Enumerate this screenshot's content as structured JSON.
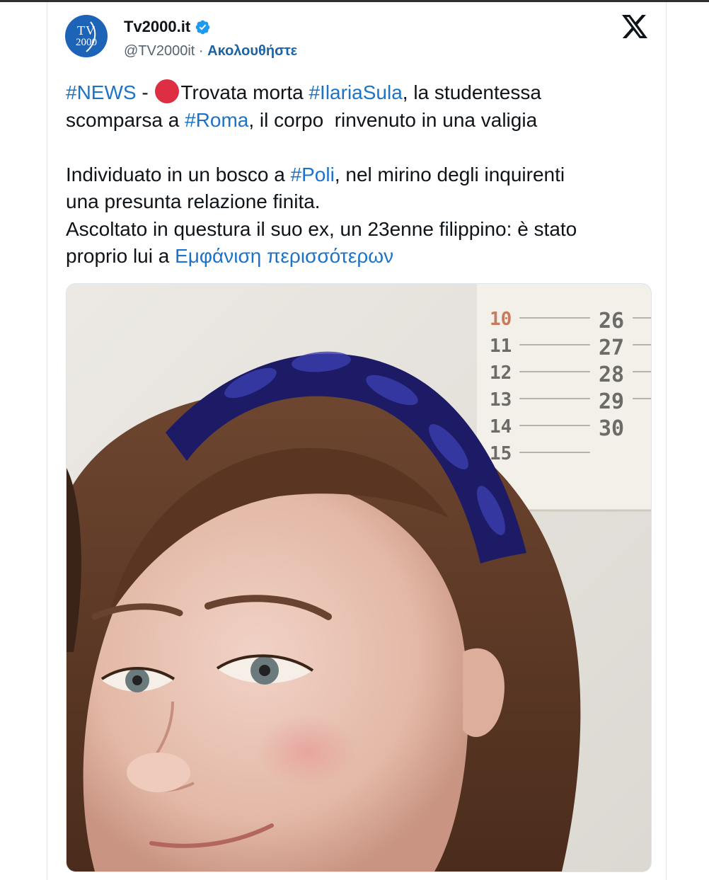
{
  "account": {
    "name": "Tv2000.it",
    "handle": "@TV2000it",
    "separator": "·",
    "follow_label": "Ακολουθήστε",
    "avatar_logo": [
      "TV",
      "2000"
    ]
  },
  "icons": {
    "verified": "verified-badge-icon",
    "platform": "x-logo-icon",
    "emoji": "red-circle-emoji"
  },
  "tweet": {
    "line1": {
      "tag_news": "#NEWS",
      "dash": " - ",
      "text_a": "Trovata morta ",
      "tag_person": "#IlariaSula",
      "text_b": ", la studentessa"
    },
    "line2": {
      "text_a": "scomparsa a ",
      "tag_city": "#Roma",
      "text_b": ", il corpo  rinvenuto in una valigia"
    },
    "line3": {
      "text_a": "Individuato in un bosco a ",
      "tag_town": "#Poli",
      "text_b": ", nel mirino degli inquirenti"
    },
    "line4": "una presunta relazione finita.",
    "line5": "Ascoltato in questura il suo ex, un 23enne filippino: è stato",
    "line6": {
      "text_a": "proprio lui a ",
      "show_more": "Εμφάνιση περισσότερων"
    }
  },
  "media": {
    "calendar_left": [
      "10",
      "11",
      "12",
      "13",
      "14",
      "15"
    ],
    "calendar_right": [
      "26",
      "27",
      "28",
      "29",
      "30"
    ]
  },
  "colors": {
    "link": "#1d73c8",
    "follow": "#1d63a5",
    "verified": "#1d9bf0",
    "emoji_red": "#dd2e44",
    "text": "#0f1419",
    "muted": "#536471"
  }
}
